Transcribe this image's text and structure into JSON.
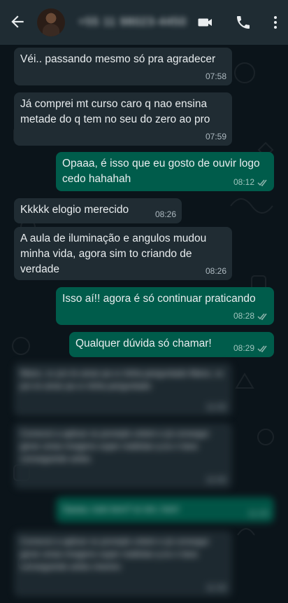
{
  "header": {
    "contact": "+55 11 98023-4450",
    "back_icon": "arrow-left-icon",
    "video_icon": "videocam-icon",
    "call_icon": "phone-icon",
    "menu_icon": "more-vertical-icon"
  },
  "colors": {
    "header_bg": "#1f2c33",
    "chat_bg": "#0b141a",
    "incoming": "#202c33",
    "outgoing": "#005c4b",
    "tick": "#8fb5ad"
  },
  "messages": [
    {
      "dir": "in",
      "text": "Véi.. passando mesmo só pra agradecer",
      "time": "07:58"
    },
    {
      "dir": "in",
      "text": "Já comprei mt curso caro q nao ensina metade do q tem no seu do zero ao pro",
      "time": "07:59"
    },
    {
      "dir": "out",
      "text": "Opaaa, é isso que eu gosto de ouvir logo cedo hahahah",
      "time": "08:12"
    },
    {
      "dir": "in",
      "text": "Kkkkk elogio merecido",
      "time": "08:26"
    },
    {
      "dir": "in",
      "text": "A aula de iluminação e angulos mudou minha vida, agora sim to criando de verdade",
      "time": "08:26"
    },
    {
      "dir": "out",
      "text": "Isso aí!! agora é só continuar praticando",
      "time": "08:28"
    },
    {
      "dir": "out",
      "text": "Qualquer dúvida só chamar!",
      "time": "08:29"
    },
    {
      "dir": "in",
      "text": "Mano, vc pro te amar pa cc tinha perguntado Mano, vc pro te amar pa cc tinha perguntado",
      "time": "11:02"
    },
    {
      "dir": "in",
      "text": "Comecei a aplicar os prompts ontem e já consegui gerar umas imagens super realistas q eu n tava conseguindo antes",
      "time": "11:02"
    },
    {
      "dir": "out",
      "text": "Opaaa, tudo bem? aí sim, hein!",
      "time": "11:20"
    },
    {
      "dir": "in",
      "text": "Comecei a aplicar os prompts ontem e já consegui gerar umas imagens super realistas q eu n tava conseguindo antes mesmo",
      "time": "11:32"
    }
  ]
}
